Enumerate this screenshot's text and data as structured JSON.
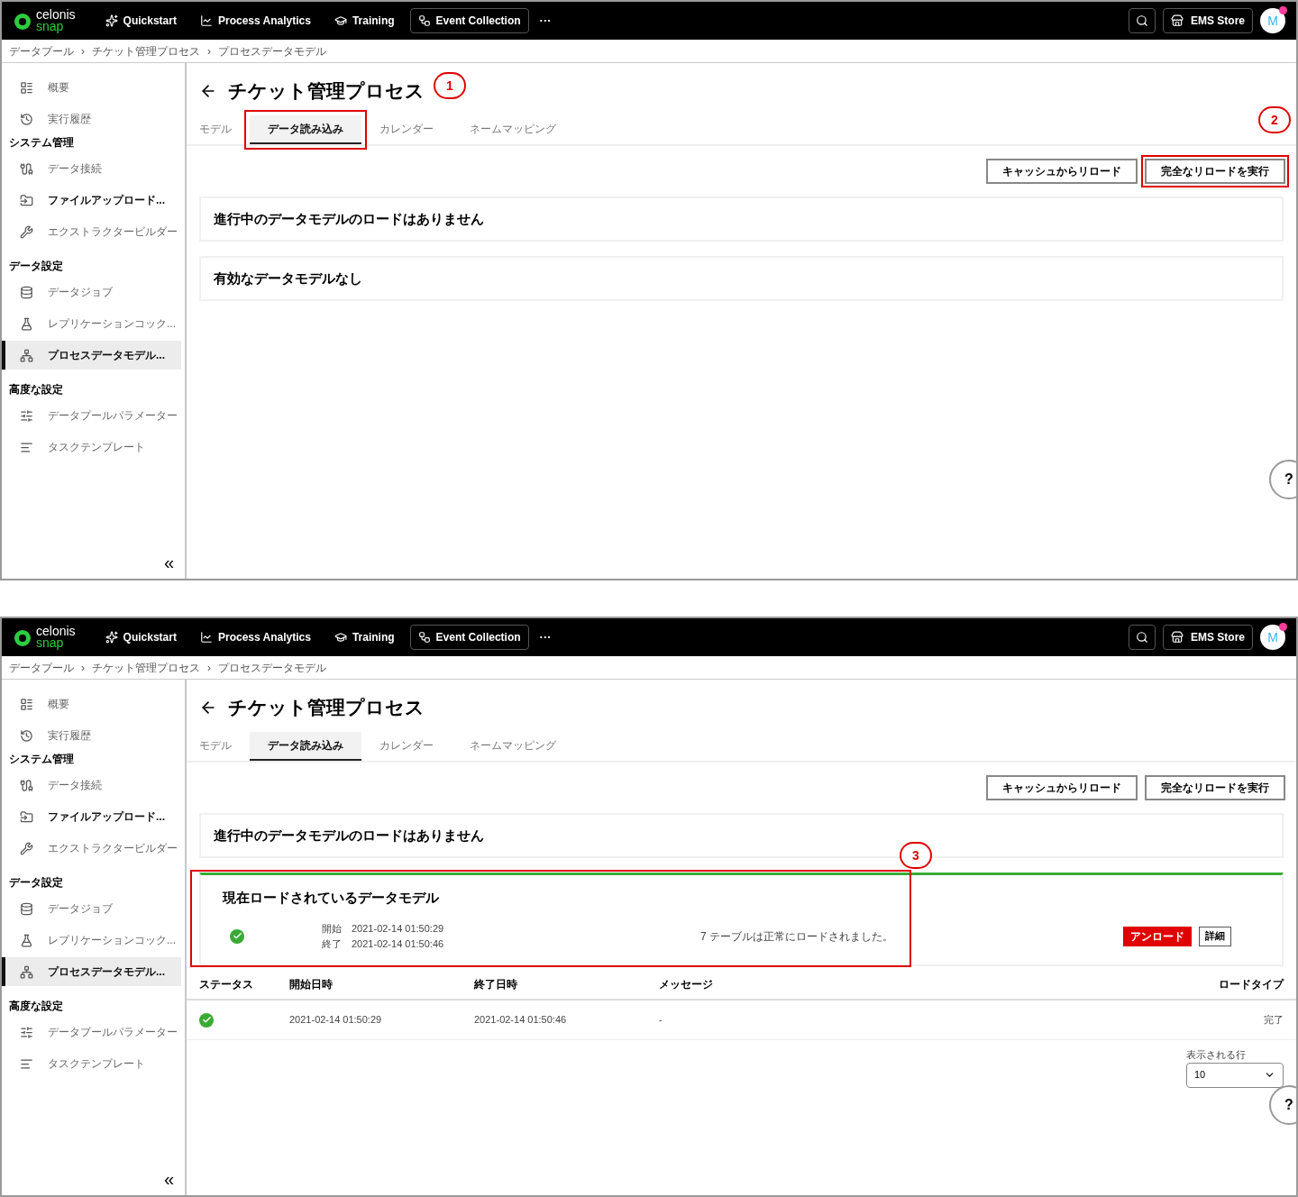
{
  "panels": [
    {
      "nav": {
        "logo_top": "celonis",
        "logo_bottom": "snap",
        "items": [
          {
            "label": "Quickstart",
            "selected": false
          },
          {
            "label": "Process Analytics",
            "selected": false
          },
          {
            "label": "Training",
            "selected": false
          },
          {
            "label": "Event Collection",
            "selected": true
          }
        ],
        "more": "···",
        "store": "EMS Store",
        "avatar": "M"
      },
      "breadcrumb": {
        "separator": "›",
        "items": [
          "データプール",
          "チケット管理プロセス",
          "プロセスデータモデル"
        ]
      },
      "sidebar": {
        "sections": [
          {
            "items": [
              {
                "label": "概要",
                "bold": false,
                "selected": false
              },
              {
                "label": "実行履歴",
                "bold": false,
                "selected": false
              }
            ]
          },
          {
            "heading": "システム管理",
            "items": [
              {
                "label": "データ接続",
                "bold": false,
                "selected": false
              },
              {
                "label": "ファイルアップロード...",
                "bold": true,
                "selected": false
              },
              {
                "label": "エクストラクタービルダー",
                "bold": false,
                "selected": false
              }
            ]
          },
          {
            "heading": "データ設定",
            "items": [
              {
                "label": "データジョブ",
                "bold": false,
                "selected": false
              },
              {
                "label": "レプリケーションコック...",
                "bold": false,
                "selected": false
              },
              {
                "label": "プロセスデータモデル...",
                "bold": true,
                "selected": true
              }
            ]
          },
          {
            "heading": "高度な設定",
            "items": [
              {
                "label": "データプールパラメーター",
                "bold": false,
                "selected": false
              },
              {
                "label": "タスクテンプレート",
                "bold": false,
                "selected": false
              }
            ]
          }
        ],
        "collapse": "«"
      },
      "title": "チケット管理プロセス",
      "tabs": [
        {
          "label": "モデル",
          "selected": false
        },
        {
          "label": "データ読み込み",
          "selected": true,
          "callout": "1"
        },
        {
          "label": "カレンダー",
          "selected": false
        },
        {
          "label": "ネームマッピング",
          "selected": false
        }
      ],
      "actions": [
        {
          "label": "キャッシュからリロード"
        },
        {
          "label": "完全なリロードを実行",
          "callout": "2"
        }
      ],
      "cards": [
        {
          "kind": "message",
          "text": "進行中のデータモデルのロードはありません"
        },
        {
          "kind": "message",
          "text": "有効なデータモデルなし"
        }
      ],
      "help": "?"
    },
    {
      "nav": {
        "logo_top": "celonis",
        "logo_bottom": "snap",
        "items": [
          {
            "label": "Quickstart",
            "selected": false
          },
          {
            "label": "Process Analytics",
            "selected": false
          },
          {
            "label": "Training",
            "selected": false
          },
          {
            "label": "Event Collection",
            "selected": true
          }
        ],
        "more": "···",
        "store": "EMS Store",
        "avatar": "M"
      },
      "breadcrumb": {
        "separator": "›",
        "items": [
          "データプール",
          "チケット管理プロセス",
          "プロセスデータモデル"
        ]
      },
      "sidebar": {
        "sections": [
          {
            "items": [
              {
                "label": "概要",
                "bold": false,
                "selected": false
              },
              {
                "label": "実行履歴",
                "bold": false,
                "selected": false
              }
            ]
          },
          {
            "heading": "システム管理",
            "items": [
              {
                "label": "データ接続",
                "bold": false,
                "selected": false
              },
              {
                "label": "ファイルアップロード...",
                "bold": true,
                "selected": false
              },
              {
                "label": "エクストラクタービルダー",
                "bold": false,
                "selected": false
              }
            ]
          },
          {
            "heading": "データ設定",
            "items": [
              {
                "label": "データジョブ",
                "bold": false,
                "selected": false
              },
              {
                "label": "レプリケーションコック...",
                "bold": false,
                "selected": false
              },
              {
                "label": "プロセスデータモデル...",
                "bold": true,
                "selected": true
              }
            ]
          },
          {
            "heading": "高度な設定",
            "items": [
              {
                "label": "データプールパラメーター",
                "bold": false,
                "selected": false
              },
              {
                "label": "タスクテンプレート",
                "bold": false,
                "selected": false
              }
            ]
          }
        ],
        "collapse": "«"
      },
      "title": "チケット管理プロセス",
      "tabs": [
        {
          "label": "モデル",
          "selected": false
        },
        {
          "label": "データ読み込み",
          "selected": true
        },
        {
          "label": "カレンダー",
          "selected": false
        },
        {
          "label": "ネームマッピング",
          "selected": false
        }
      ],
      "actions": [
        {
          "label": "キャッシュからリロード"
        },
        {
          "label": "完全なリロードを実行"
        }
      ],
      "cards": [
        {
          "kind": "message",
          "text": "進行中のデータモデルのロードはありません"
        },
        {
          "kind": "current",
          "title": "現在ロードされているデータモデル",
          "callout": "3",
          "start_label": "開始",
          "start": "2021-02-14 01:50:29",
          "end_label": "終了",
          "end": "2021-02-14 01:50:46",
          "message": "7 テーブルは正常にロードされました。",
          "unload": "アンロード",
          "details": "詳細"
        }
      ],
      "table": {
        "columns": [
          "ステータス",
          "開始日時",
          "終了日時",
          "メッセージ",
          "ロードタイプ"
        ],
        "rows": [
          {
            "success": true,
            "start": "2021-02-14 01:50:29",
            "end": "2021-02-14 01:50:46",
            "message": "-",
            "type": "完了"
          }
        ],
        "rows_label": "表示される行",
        "rows_value": "10"
      },
      "help": "?"
    }
  ]
}
